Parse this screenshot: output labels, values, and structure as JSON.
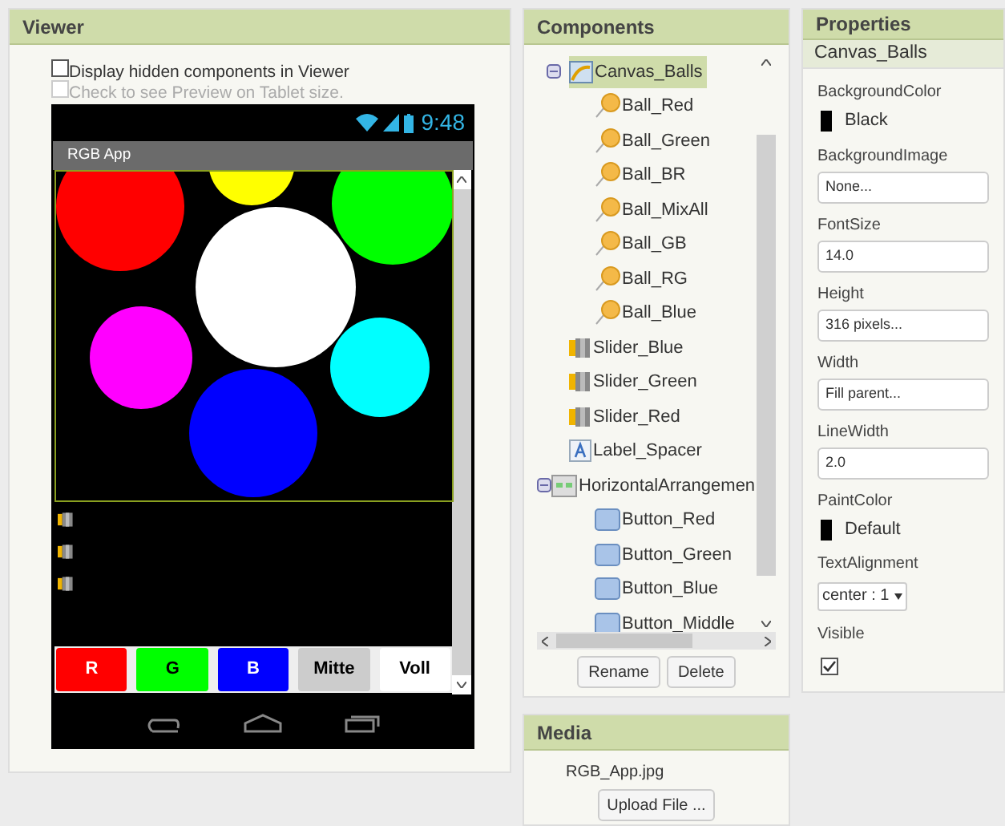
{
  "viewer": {
    "title": "Viewer",
    "options": [
      {
        "label": "Display hidden components in Viewer",
        "checked": false,
        "disabled": false
      },
      {
        "label": "Check to see Preview on Tablet size.",
        "checked": false,
        "disabled": true
      }
    ],
    "phone": {
      "time": "9:48",
      "app_title": "RGB App",
      "balls": [
        {
          "color": "#ff0000"
        },
        {
          "color": "#ffff00"
        },
        {
          "color": "#00ff00"
        },
        {
          "color": "#ffffff"
        },
        {
          "color": "#ff00ff"
        },
        {
          "color": "#00ffff"
        },
        {
          "color": "#0000ff"
        }
      ],
      "sliders": [
        {
          "kind": "slider"
        },
        {
          "kind": "slider"
        },
        {
          "kind": "slider"
        }
      ],
      "buttons": [
        {
          "label": "R",
          "color": "#ff0000"
        },
        {
          "label": "G",
          "color": "#00ff00"
        },
        {
          "label": "B",
          "color": "#0000ff"
        },
        {
          "label": "Mitte",
          "color": "#cccccc"
        },
        {
          "label": "Voll",
          "color": "#ffffff"
        }
      ]
    }
  },
  "components": {
    "title": "Components",
    "tree": [
      {
        "label": "Canvas_Balls",
        "kind": "canvas",
        "selected": true,
        "expanded": true,
        "children": [
          {
            "label": "Ball_Red",
            "kind": "ball",
            "selected": false
          },
          {
            "label": "Ball_Green",
            "kind": "ball",
            "selected": false
          },
          {
            "label": "Ball_BR",
            "kind": "ball",
            "selected": false
          },
          {
            "label": "Ball_MixAll",
            "kind": "ball",
            "selected": false
          },
          {
            "label": "Ball_GB",
            "kind": "ball",
            "selected": false
          },
          {
            "label": "Ball_RG",
            "kind": "ball",
            "selected": false
          },
          {
            "label": "Ball_Blue",
            "kind": "ball",
            "selected": false
          }
        ]
      },
      {
        "label": "Slider_Blue",
        "kind": "slider",
        "selected": false
      },
      {
        "label": "Slider_Green",
        "kind": "slider",
        "selected": false
      },
      {
        "label": "Slider_Red",
        "kind": "slider",
        "selected": false
      },
      {
        "label": "Label_Spacer",
        "kind": "label",
        "selected": false
      },
      {
        "label": "HorizontalArrangemen",
        "kind": "arrangement",
        "selected": false,
        "expanded": true,
        "children": [
          {
            "label": "Button_Red",
            "kind": "button",
            "selected": false
          },
          {
            "label": "Button_Green",
            "kind": "button",
            "selected": false
          },
          {
            "label": "Button_Blue",
            "kind": "button",
            "selected": false
          },
          {
            "label": "Button_Middle",
            "kind": "button",
            "selected": false
          }
        ]
      }
    ],
    "buttons": [
      "Rename",
      "Delete"
    ]
  },
  "media": {
    "title": "Media",
    "files": [
      "RGB_App.jpg"
    ],
    "upload": "Upload File ..."
  },
  "properties": {
    "title": "Properties",
    "component": "Canvas_Balls",
    "items": [
      {
        "name": "BackgroundColor",
        "kind": "color",
        "value": "Black",
        "color": "#000000"
      },
      {
        "name": "BackgroundImage",
        "kind": "text",
        "value": "None..."
      },
      {
        "name": "FontSize",
        "kind": "text",
        "value": "14.0"
      },
      {
        "name": "Height",
        "kind": "text",
        "value": "316 pixels..."
      },
      {
        "name": "Width",
        "kind": "text",
        "value": "Fill parent..."
      },
      {
        "name": "LineWidth",
        "kind": "text",
        "value": "2.0"
      },
      {
        "name": "PaintColor",
        "kind": "color",
        "value": "Default",
        "color": "#000000"
      },
      {
        "name": "TextAlignment",
        "kind": "select",
        "value": "center : 1"
      },
      {
        "name": "Visible",
        "kind": "checkbox",
        "checked": true
      }
    ]
  }
}
